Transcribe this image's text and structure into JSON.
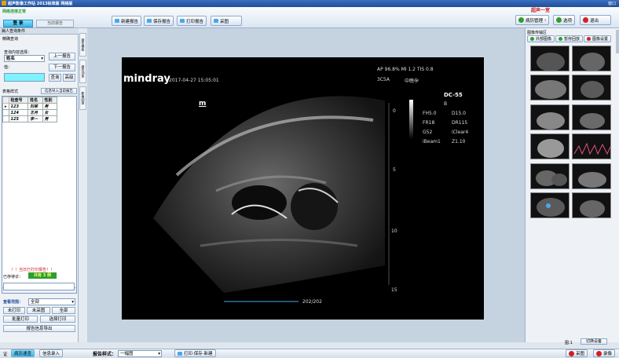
{
  "app": {
    "title": "超声影像工作站 2013标准版 网络版",
    "menu_label": "窗口",
    "status_label": "网络连接正常",
    "tabs": [
      "登 录",
      "当前报告"
    ]
  },
  "toolbar": {
    "new_report": "新建报告",
    "save_report": "保存报告",
    "print_report": "打印报告",
    "capture": "采图",
    "room_label": "超声一室",
    "history": "病历管理",
    "options": "选项",
    "exit": "退出"
  },
  "left_panel": {
    "header": "病人查询条件",
    "section_label": "精确查询",
    "query_condition_label": "查询内容选择：",
    "field_select": "姓名",
    "value_label": "值：",
    "prev_button": "上一报告",
    "next_button": "下一报告",
    "query_button": "查询",
    "clear_button": "高级",
    "list_style_label": "表格样式",
    "import_label": "信息导入当前报告",
    "table_headers": [
      "检查号",
      "姓名",
      "性别"
    ],
    "table_rows": [
      [
        "123",
        "刘某",
        "男"
      ],
      [
        "124",
        "王月",
        "女"
      ],
      [
        "125",
        "李一",
        "男"
      ]
    ],
    "warning_text": "！！当日已打印报告！！",
    "waiting_label": "已存待诊：",
    "waiting_value": "共有 3 例",
    "view_label": "查看范围：",
    "view_select": "全部",
    "btn_unprinted": "未打印",
    "btn_uncaptured": "未采图",
    "btn_all": "全部",
    "btn_batch_print": "批量打印",
    "btn_select_print": "选择打印",
    "btn_export": "报告信息导出"
  },
  "vtabs": [
    "报告模板",
    "报告词条",
    "影像回放"
  ],
  "ultrasound": {
    "brand": "mindray",
    "datetime": "2017-04-27 15:05:01",
    "ap": "AP 96.8%  MI 1.2  TIS 0.8",
    "probe": "3C5A",
    "mode": "中晚孕",
    "preset": "DC-55",
    "b": "B",
    "params_left": [
      "FH5.0",
      "FR18",
      "G52",
      "iBeam1"
    ],
    "params_right": [
      "D15.0",
      "DR115",
      "iClear4",
      "Z1.10"
    ],
    "scale": [
      "0",
      "5",
      "10",
      "15"
    ],
    "frame": "202/202"
  },
  "right_panel": {
    "header": "图像传输区",
    "btn_outsource": "外部图像",
    "btn_range": "暂存回放",
    "btn_settings": "图像设置",
    "thumb_count": "图:1",
    "btn_device": "切换设备"
  },
  "bottombar": {
    "item1": "证",
    "item2": "病历速查",
    "item3": "信息录入",
    "template_label": "报告样式：",
    "template_value": "一幅图",
    "print_save": "打印·保存·新建",
    "capture": "采图",
    "record": "录像"
  },
  "colors": {
    "accent": "#1f4e9a",
    "green": "#2e9e2e",
    "red": "#d02020",
    "cyan": "#7ff2ff"
  }
}
